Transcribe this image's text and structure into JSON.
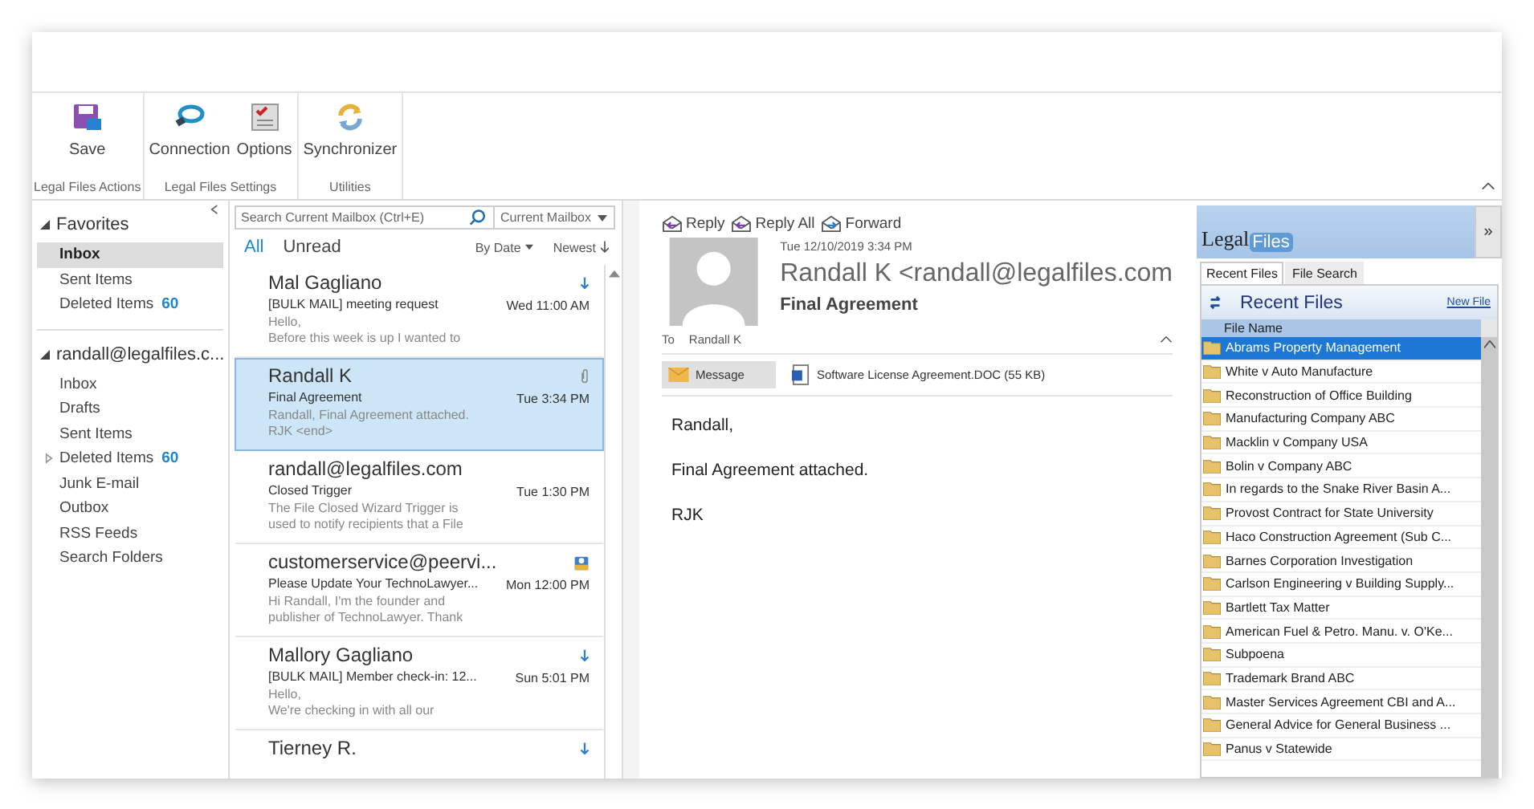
{
  "ribbon": {
    "groups": [
      {
        "label": "Legal Files Actions",
        "buttons": [
          {
            "label": "Save"
          }
        ]
      },
      {
        "label": "Legal Files Settings",
        "buttons": [
          {
            "label": "Connection"
          },
          {
            "label": "Options"
          }
        ]
      },
      {
        "label": "Utilities",
        "buttons": [
          {
            "label": "Synchronizer"
          }
        ]
      }
    ]
  },
  "folders": {
    "favorites": {
      "label": "Favorites",
      "expanded": true,
      "items": [
        {
          "label": "Inbox",
          "selected": true
        },
        {
          "label": "Sent Items",
          "selected": false
        },
        {
          "label": "Deleted Items",
          "count": "60",
          "selected": false
        }
      ]
    },
    "account": {
      "label": "randall@legalfiles.c...",
      "expanded": true,
      "items": [
        {
          "label": "Inbox",
          "selected": false
        },
        {
          "label": "Drafts",
          "selected": false
        },
        {
          "label": "Sent Items",
          "selected": false
        },
        {
          "label": "Deleted Items",
          "count": "60",
          "expanded": false,
          "selected": false
        },
        {
          "label": "Junk E-mail",
          "selected": false
        },
        {
          "label": "Outbox",
          "selected": false
        },
        {
          "label": "RSS Feeds",
          "selected": false
        },
        {
          "label": "Search Folders",
          "selected": false
        }
      ]
    }
  },
  "mail_list": {
    "search_placeholder": "Search Current Mailbox (Ctrl+E)",
    "scope": "Current Mailbox",
    "filters": [
      {
        "label": "All",
        "selected": true
      },
      {
        "label": "Unread",
        "selected": false
      }
    ],
    "sort": "By Date",
    "order": "Newest",
    "messages": [
      {
        "sender": "Mal Gagliano",
        "subject": "[BULK MAIL]  meeting request",
        "time": "Wed 11:00 AM",
        "preview": [
          "Hello,",
          "Before this week is up I wanted to"
        ],
        "kind": "low-priority",
        "bold_subject": false,
        "selected": false
      },
      {
        "sender": "Randall K",
        "subject": "Final Agreement",
        "time": "Tue 3:34 PM",
        "preview": [
          "Randall,  Final Agreement attached.",
          "RJK <end>"
        ],
        "kind": "attachment",
        "bold_subject": false,
        "selected": true
      },
      {
        "sender": "randall@legalfiles.com",
        "subject": "Closed Trigger",
        "time": "Tue 1:30 PM",
        "preview": [
          "The File Closed Wizard Trigger is",
          "used to notify recipients that a File"
        ],
        "bold_subject": false,
        "selected": false
      },
      {
        "sender": "customerservice@peervi...",
        "subject": "Please Update Your TechnoLawyer...",
        "time": "Mon 12:00 PM",
        "preview": [
          "Hi Randall,  I'm the founder and",
          "publisher of TechnoLawyer. Thank"
        ],
        "kind": "contact",
        "bold_subject": false,
        "selected": false
      },
      {
        "sender": "Mallory Gagliano",
        "subject": "[BULK MAIL]  Member check-in: 12...",
        "time": "Sun 5:01 PM",
        "preview": [
          "Hello,",
          "We're checking in with all our"
        ],
        "kind": "low-priority",
        "bold_subject": false,
        "selected": false
      },
      {
        "sender": "Tierney R.",
        "kind": "low-priority",
        "selected": false
      }
    ]
  },
  "reading": {
    "actions": [
      "Reply",
      "Reply All",
      "Forward"
    ],
    "date": "Tue 12/10/2019 3:34 PM",
    "from": "Randall K <randall@legalfiles.com",
    "subject": "Final Agreement",
    "to_label": "To",
    "to": "Randall K",
    "attachments": [
      {
        "label": "Message",
        "kind": "message",
        "selected": true
      },
      {
        "label": "Software License Agreement.DOC (55 KB)",
        "kind": "doc",
        "selected": false
      }
    ],
    "body": [
      "Randall,",
      "Final Agreement attached.",
      "RJK"
    ]
  },
  "legal_files": {
    "logo": [
      "Legal",
      "Files"
    ],
    "expand": "»",
    "tabs": [
      {
        "label": "Recent Files",
        "selected": true
      },
      {
        "label": "File Search",
        "selected": false
      }
    ],
    "title": "Recent Files",
    "new_file": "New File",
    "column": "File Name",
    "files": [
      {
        "name": "Abrams Property Management",
        "selected": true
      },
      {
        "name": "White v Auto Manufacture",
        "selected": false
      },
      {
        "name": "Reconstruction of Office Building",
        "selected": false
      },
      {
        "name": "Manufacturing Company ABC",
        "selected": false
      },
      {
        "name": "Macklin v Company USA",
        "selected": false
      },
      {
        "name": "Bolin v Company ABC",
        "selected": false
      },
      {
        "name": "In regards to the Snake River Basin A...",
        "selected": false
      },
      {
        "name": "Provost Contract for State University",
        "selected": false
      },
      {
        "name": "Haco Construction Agreement (Sub C...",
        "selected": false
      },
      {
        "name": "Barnes Corporation Investigation",
        "selected": false
      },
      {
        "name": "Carlson Engineering v Building Supply...",
        "selected": false
      },
      {
        "name": "Bartlett Tax Matter",
        "selected": false
      },
      {
        "name": "American Fuel & Petro. Manu. v. O'Ke...",
        "selected": false
      },
      {
        "name": "Subpoena",
        "selected": false
      },
      {
        "name": "Trademark Brand ABC",
        "selected": false
      },
      {
        "name": "Master Services Agreement CBI and A...",
        "selected": false
      },
      {
        "name": "General Advice for General Business ...",
        "selected": false
      },
      {
        "name": "Panus v Statewide",
        "selected": false
      }
    ]
  }
}
